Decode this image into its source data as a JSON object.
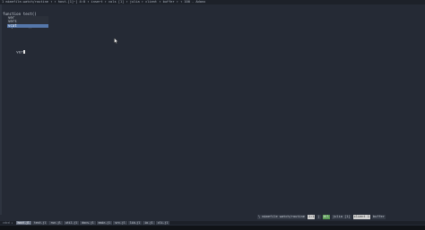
{
  "window": {
    "title": "1 mimefile-watch/routine ↑ ↑ host-[1]~] 4:0 ↑ insert ↑ cols [1] ↑ julia ↑ client ↑ buffer ↑ ↑ 100 - Adanx"
  },
  "editor": {
    "lines": [
      "function test()",
      "    println()",
      "",
      "      ver"
    ],
    "completion": {
      "items": [
        "ver",
        "vers",
        "vcat"
      ],
      "selected_index": 2
    }
  },
  "status": {
    "segments": [
      "\\ mimefile watch/routine",
      "1:1",
      "All",
      "julia [1]",
      "client 1",
      "buffer"
    ],
    "accent_segment": "All"
  },
  "tabs": {
    "label": "cdcd ▸",
    "items": [
      "host.jl",
      "test.jl",
      "run.jl",
      "util.jl",
      "docs.jl",
      "main.jl",
      "src.jl",
      "lib.jl",
      "io.jl",
      "cli.jl"
    ]
  }
}
